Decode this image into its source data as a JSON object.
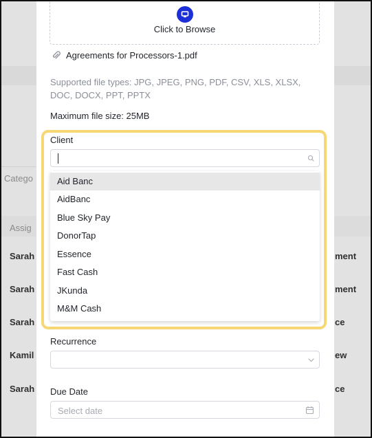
{
  "background": {
    "category_placeholder": "Catego",
    "assign_header": "Assig",
    "rows_left": [
      "Sarah",
      "Sarah",
      "Sarah",
      "Kamil I",
      "Sarah"
    ],
    "rows_right": [
      "ment",
      "ment",
      "ce",
      "ew",
      "ce"
    ]
  },
  "upload": {
    "browse_label": "Click to Browse",
    "attached_file": "Agreements for Processors-1.pdf",
    "supported_types": "Supported file types: JPG, JPEG, PNG, PDF, CSV, XLS, XLSX, DOC, DOCX, PPT, PPTX",
    "max_size": "Maximum file size: 25MB"
  },
  "client": {
    "label": "Client",
    "search_value": "",
    "options": [
      "Aid Banc",
      "AidBanc",
      "Blue Sky Pay",
      "DonorTap",
      "Essence",
      "Fast Cash",
      "JKunda",
      "M&M Cash"
    ],
    "selected_index": 0
  },
  "recurrence": {
    "label": "Recurrence",
    "value": ""
  },
  "due_date": {
    "label": "Due Date",
    "placeholder": "Select date"
  },
  "colors": {
    "accent": "#1d2fd6",
    "highlight": "#f7d774"
  }
}
